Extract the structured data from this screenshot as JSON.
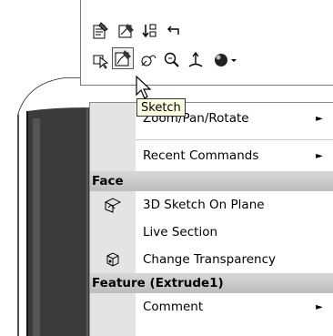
{
  "tooltip": {
    "text": "Sketch"
  },
  "toolbar": {
    "row1": [
      "part-properties-icon",
      "edit-sketch-icon",
      "rebuild-order-icon",
      "return-icon"
    ],
    "row2": [
      "select-other-icon",
      "sketch-icon",
      "view-orientation-icon",
      "zoom-to-selection-icon",
      "normal-to-icon",
      "appearance-icon"
    ]
  },
  "menu": {
    "items_top": [
      {
        "label": "Zoom/Pan/Rotate",
        "has_submenu": true
      },
      {
        "label": "Recent Commands",
        "has_submenu": true
      }
    ],
    "section_face": {
      "header": "Face",
      "items": [
        {
          "label": "3D Sketch On Plane"
        },
        {
          "label": "Live Section"
        },
        {
          "label": "Change Transparency"
        }
      ]
    },
    "section_feature": {
      "header": "Feature (Extrude1)",
      "items": [
        {
          "label": "Comment",
          "has_submenu": true
        }
      ]
    }
  },
  "colors": {
    "tooltip_bg": "#ffffe1",
    "menu_gutter": "#e4e4e4",
    "section_header": "#c8c8c8",
    "model_face": "#3a3a3a"
  }
}
